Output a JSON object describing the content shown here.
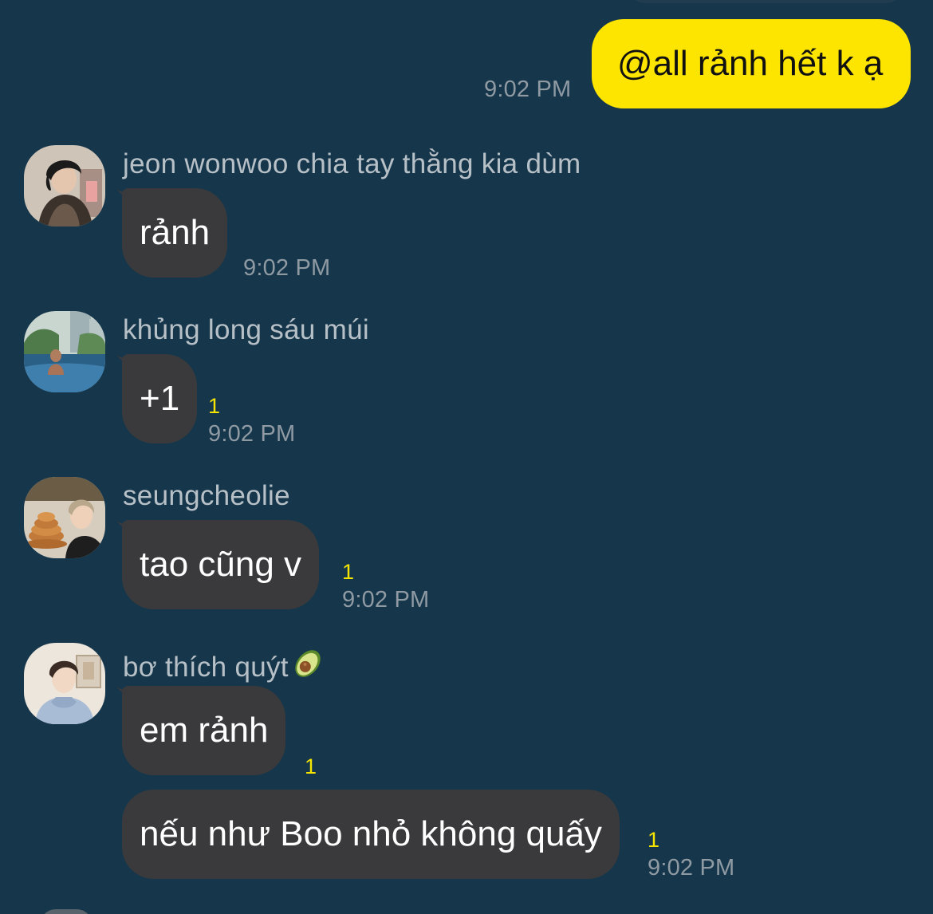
{
  "chat": {
    "outgoing": {
      "text": "@all rảnh hết k ạ",
      "time": "9:02 PM"
    },
    "messages": [
      {
        "sender": "jeon wonwoo chia tay thằng kia dùm",
        "bubbles": [
          "rảnh"
        ],
        "time": "9:02 PM",
        "unread": ""
      },
      {
        "sender": "khủng long sáu múi",
        "bubbles": [
          "+1"
        ],
        "time": "9:02 PM",
        "unread": "1"
      },
      {
        "sender": "seungcheolie",
        "bubbles": [
          "tao cũng v"
        ],
        "time": "9:02 PM",
        "unread": "1"
      },
      {
        "sender": "bơ thích quýt",
        "sender_emoji": "avocado-icon",
        "bubbles": [
          "em rảnh",
          "nếu như Boo nhỏ không quấy"
        ],
        "bubble_unread": [
          "1",
          "1"
        ],
        "time": "9:02 PM"
      }
    ]
  },
  "colors": {
    "background": "#15364b",
    "outgoing_bubble": "#fee500",
    "incoming_bubble": "#3a3a3c",
    "unread_count": "#f5e400",
    "timestamp": "#8f9aa3"
  }
}
